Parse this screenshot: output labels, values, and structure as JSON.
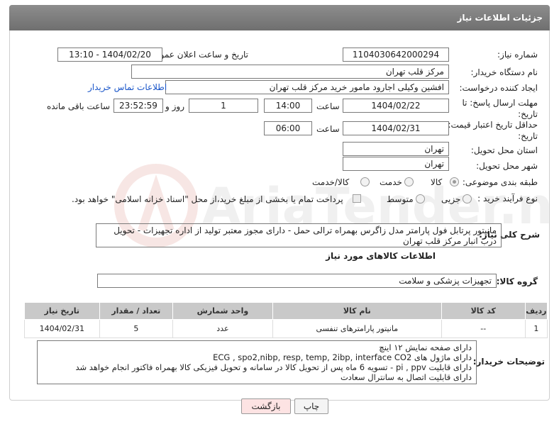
{
  "header": {
    "title": "جزئیات اطلاعات نیاز"
  },
  "form": {
    "need_number_label": "شماره نیاز:",
    "need_number": "1104030642000294",
    "announce_label": "تاریخ و ساعت اعلان عمومی:",
    "announce_value": "1404/02/20 - 13:10",
    "buyer_org_label": "نام دستگاه خریدار:",
    "buyer_org": "مرکز قلب تهران",
    "creator_label": "ایجاد کننده درخواست:",
    "creator": "افشین وکیلی اجارود مامور خرید مرکز قلب تهران",
    "buyer_contact_link": "اطلاعات تماس خریدار",
    "reply_deadline_label": "مهلت ارسال پاسخ: تا تاریخ:",
    "reply_date": "1404/02/22",
    "time_label": "ساعت",
    "reply_time": "14:00",
    "days_value": "1",
    "days_label": "روز و",
    "remaining_time": "23:52:59",
    "remaining_label": "ساعت باقی مانده",
    "price_validity_label": "حداقل تاریخ اعتبار قیمت: تا تاریخ:",
    "validity_date": "1404/02/31",
    "validity_time": "06:00",
    "province_label": "استان محل تحویل:",
    "province": "تهران",
    "city_label": "شهر محل تحویل:",
    "city": "تهران",
    "category_label": "طبقه بندی موضوعی:",
    "category_options": [
      "کالا",
      "خدمت",
      "کالا/خدمت"
    ],
    "process_label": "نوع فرآیند خرید :",
    "process_options": [
      "جزیی",
      "متوسط"
    ],
    "payment_note": "پرداخت تمام یا بخشی از مبلغ خرید،از محل \"اسناد خزانه اسلامی\" خواهد بود.",
    "description_label": "شرح کلی نیاز:",
    "description": "مانیتور پرتابل فول پارامتر مدل زاگرس بهمراه ترالی حمل - دارای مجوز معتبر تولید از اداره تجهیزات - تحویل درب انبار مرکز قلب تهران"
  },
  "goods": {
    "section_title": "اطلاعات کالاهای مورد نیاز",
    "group_label": "گروه کالا:",
    "group_value": "تجهیزات پزشکی و سلامت",
    "columns": [
      "ردیف",
      "کد کالا",
      "نام کالا",
      "واحد شمارش",
      "تعداد / مقدار",
      "تاریخ نیاز"
    ],
    "rows": [
      [
        "1",
        "--",
        "مانیتور پارامترهای تنفسی",
        "عدد",
        "5",
        "1404/02/31"
      ]
    ]
  },
  "buyer_notes": {
    "label": "توضیحات خریدار:",
    "lines": [
      "دارای صفحه نمایش ۱۲ اینچ",
      "دارای ماژول های ECG , spo2,nibp, resp, temp, 2ibp, interface CO2",
      "دارای قابلیت pi , ppv - تسویه 6 ماه پس از تحویل کالا در سامانه و تحویل فیزیکی کالا بهمراه فاکتور انجام خواهد شد",
      "دارای قابلیت اتصال به سانترال سعادت"
    ]
  },
  "buttons": {
    "print": "چاپ",
    "back": "بازگشت"
  },
  "watermark": {
    "text": "AriaTender.neT"
  },
  "colors": {
    "header_bg": "#7d7d7d",
    "link": "#1a56c9",
    "back_button_bg": "#fde3e3",
    "table_header_bg": "#c9c9c9"
  }
}
